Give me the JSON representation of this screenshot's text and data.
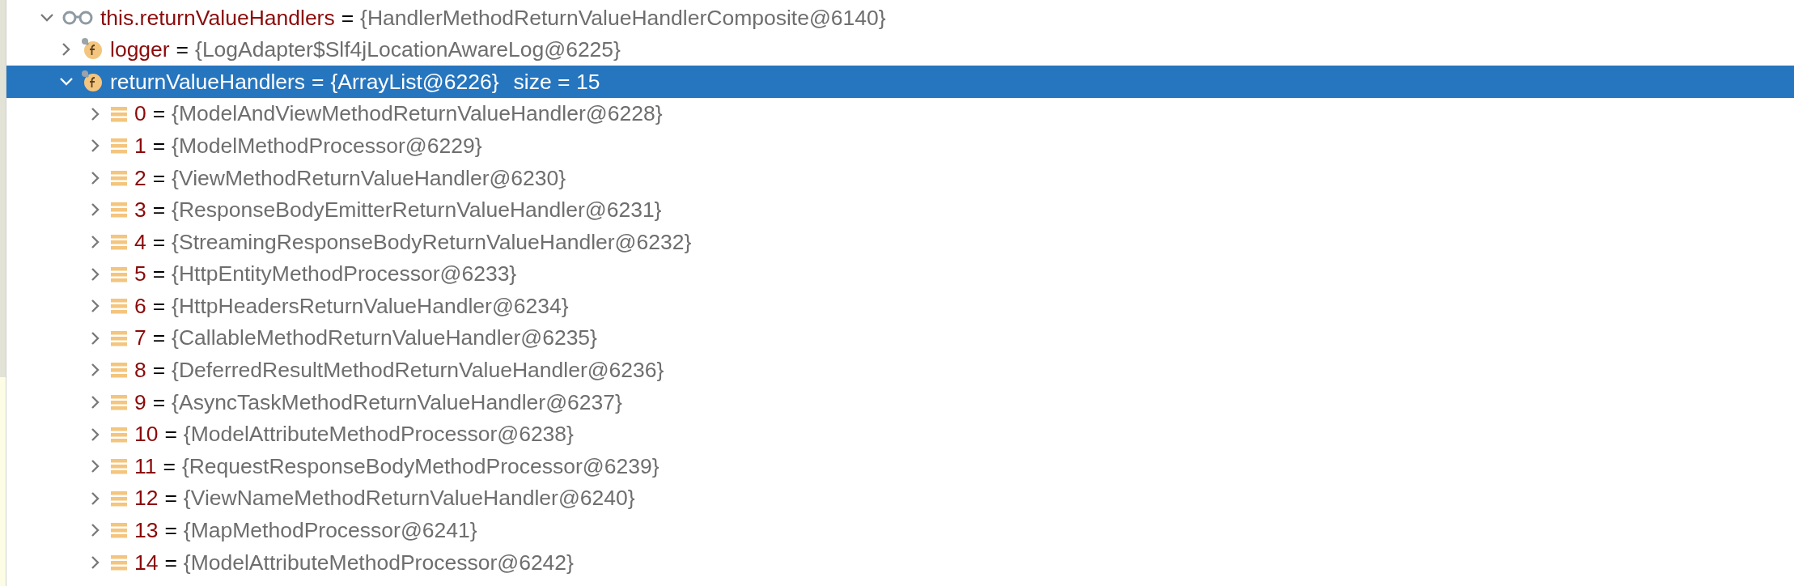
{
  "variables": {
    "kind": "watch",
    "name": "this.returnValueHandlers",
    "sep": "=",
    "value": "{HandlerMethodReturnValueHandlerComposite@6140}",
    "expanded": true,
    "selected": false,
    "children": [
      {
        "kind": "field",
        "name": "logger",
        "sep": "=",
        "value": "{LogAdapter$Slf4jLocationAwareLog@6225}",
        "expanded": false,
        "selected": false
      },
      {
        "kind": "field",
        "name": "returnValueHandlers",
        "sep": "=",
        "value": "{ArrayList@6226}",
        "extra": "size = 15",
        "expanded": true,
        "selected": true,
        "children": [
          {
            "kind": "element",
            "name": "0",
            "sep": "=",
            "value": "{ModelAndViewMethodReturnValueHandler@6228}",
            "expanded": false,
            "selected": false
          },
          {
            "kind": "element",
            "name": "1",
            "sep": "=",
            "value": "{ModelMethodProcessor@6229}",
            "expanded": false,
            "selected": false
          },
          {
            "kind": "element",
            "name": "2",
            "sep": "=",
            "value": "{ViewMethodReturnValueHandler@6230}",
            "expanded": false,
            "selected": false
          },
          {
            "kind": "element",
            "name": "3",
            "sep": "=",
            "value": "{ResponseBodyEmitterReturnValueHandler@6231}",
            "expanded": false,
            "selected": false
          },
          {
            "kind": "element",
            "name": "4",
            "sep": "=",
            "value": "{StreamingResponseBodyReturnValueHandler@6232}",
            "expanded": false,
            "selected": false
          },
          {
            "kind": "element",
            "name": "5",
            "sep": "=",
            "value": "{HttpEntityMethodProcessor@6233}",
            "expanded": false,
            "selected": false
          },
          {
            "kind": "element",
            "name": "6",
            "sep": "=",
            "value": "{HttpHeadersReturnValueHandler@6234}",
            "expanded": false,
            "selected": false
          },
          {
            "kind": "element",
            "name": "7",
            "sep": "=",
            "value": "{CallableMethodReturnValueHandler@6235}",
            "expanded": false,
            "selected": false
          },
          {
            "kind": "element",
            "name": "8",
            "sep": "=",
            "value": "{DeferredResultMethodReturnValueHandler@6236}",
            "expanded": false,
            "selected": false
          },
          {
            "kind": "element",
            "name": "9",
            "sep": "=",
            "value": "{AsyncTaskMethodReturnValueHandler@6237}",
            "expanded": false,
            "selected": false
          },
          {
            "kind": "element",
            "name": "10",
            "sep": "=",
            "value": "{ModelAttributeMethodProcessor@6238}",
            "expanded": false,
            "selected": false
          },
          {
            "kind": "element",
            "name": "11",
            "sep": "=",
            "value": "{RequestResponseBodyMethodProcessor@6239}",
            "expanded": false,
            "selected": false
          },
          {
            "kind": "element",
            "name": "12",
            "sep": "=",
            "value": "{ViewNameMethodReturnValueHandler@6240}",
            "expanded": false,
            "selected": false
          },
          {
            "kind": "element",
            "name": "13",
            "sep": "=",
            "value": "{MapMethodProcessor@6241}",
            "expanded": false,
            "selected": false
          },
          {
            "kind": "element",
            "name": "14",
            "sep": "=",
            "value": "{ModelAttributeMethodProcessor@6242}",
            "expanded": false,
            "selected": false
          }
        ]
      }
    ]
  }
}
